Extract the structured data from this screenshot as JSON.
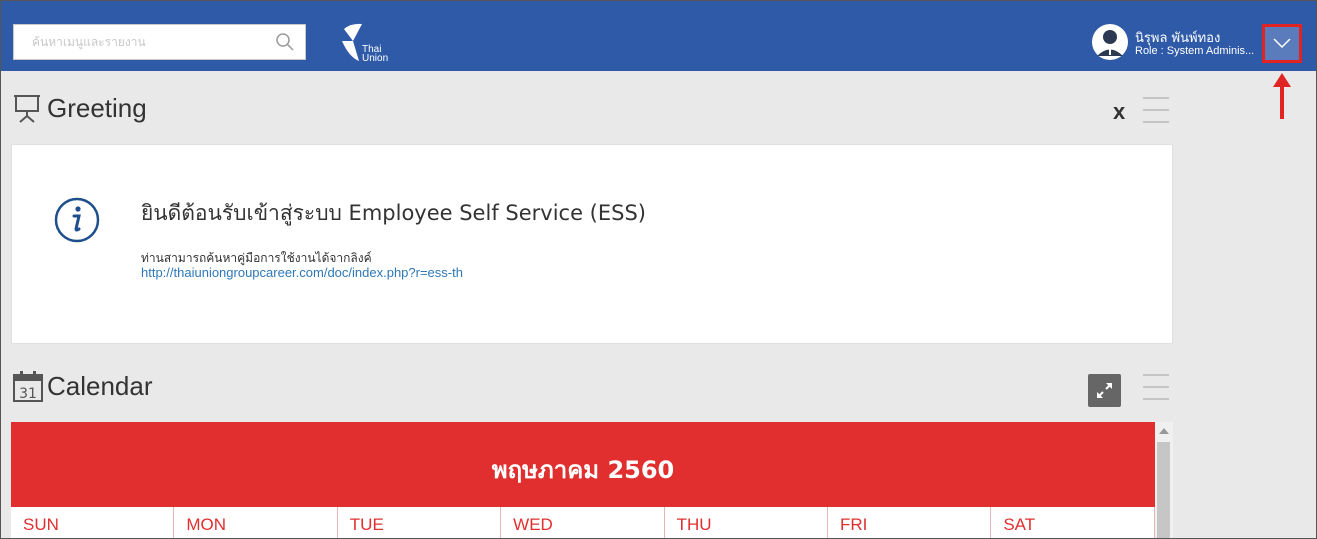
{
  "search": {
    "placeholder": "ค้นหาเมนูและรายงาน",
    "value": ""
  },
  "logo": {
    "line1": "Thai",
    "line2": "Union"
  },
  "user": {
    "name": "นิรุพล พันพ์ทอง",
    "role": "Role : System Adminis..."
  },
  "greeting": {
    "title": "Greeting",
    "close_label": "x",
    "heading": "ยินดีต้อนรับเข้าสู่ระบบ Employee Self Service (ESS)",
    "subtext": "ท่านสามารถค้นหาคู่มือการใช้งานได้จากลิงค์",
    "link": "http://thaiuniongroupcareer.com/doc/index.php?r=ess-th"
  },
  "calendar": {
    "title": "Calendar",
    "icon_number": "31",
    "month": "พฤษภาคม 2560",
    "days": [
      "SUN",
      "MON",
      "TUE",
      "WED",
      "THU",
      "FRI",
      "SAT"
    ]
  },
  "colors": {
    "topbar": "#2f5aa8",
    "calendar_header": "#e12f2f",
    "link": "#2e78b8",
    "annotation": "#e02424"
  },
  "icons": [
    "search-icon",
    "thai-union-logo-icon",
    "avatar-icon",
    "chevron-down-icon",
    "presentation-icon",
    "menu-lines-icon",
    "info-icon",
    "calendar-icon",
    "expand-icon",
    "scroll-up-icon",
    "annotation-arrow-icon"
  ]
}
